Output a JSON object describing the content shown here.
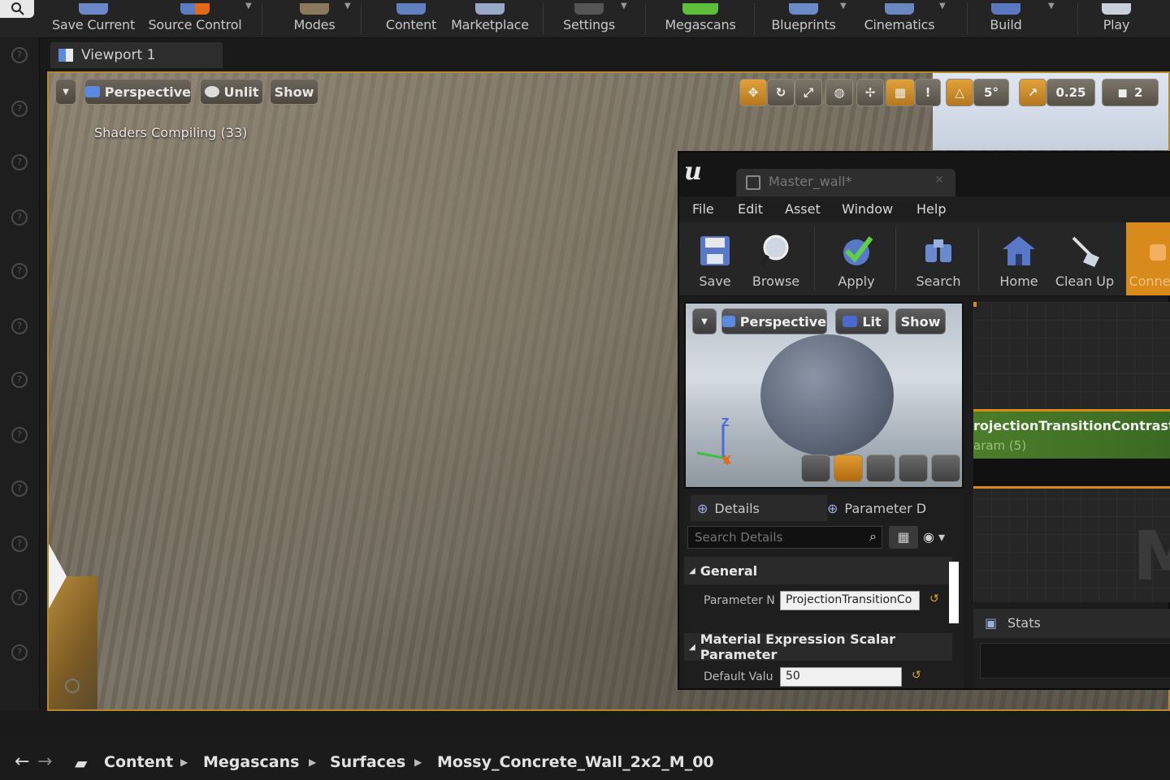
{
  "main_toolbar": {
    "buttons": [
      {
        "label": "Save Current",
        "icon": "save-icon"
      },
      {
        "label": "Source Control",
        "icon": "source-control-icon"
      },
      {
        "label": "Modes",
        "icon": "modes-icon"
      },
      {
        "label": "Content",
        "icon": "content-icon"
      },
      {
        "label": "Marketplace",
        "icon": "marketplace-icon"
      },
      {
        "label": "Settings",
        "icon": "settings-icon"
      },
      {
        "label": "Megascans",
        "icon": "megascans-icon"
      },
      {
        "label": "Blueprints",
        "icon": "blueprints-icon"
      },
      {
        "label": "Cinematics",
        "icon": "cinematics-icon"
      },
      {
        "label": "Build",
        "icon": "build-icon"
      },
      {
        "label": "Play",
        "icon": "play-icon"
      }
    ]
  },
  "viewport_tab": {
    "label": "Viewport 1"
  },
  "viewport": {
    "view_mode": "Perspective",
    "lighting_mode": "Unlit",
    "show_label": "Show",
    "status_message": "Shaders Compiling (33)",
    "snap_angle": "5°",
    "snap_scale": "0.25",
    "camera_speed": "2"
  },
  "material_editor": {
    "tab_title": "Master_wall*",
    "menu": [
      "File",
      "Edit",
      "Asset",
      "Window",
      "Help"
    ],
    "tools": [
      {
        "label": "Save",
        "icon": "save-icon"
      },
      {
        "label": "Browse",
        "icon": "browse-icon"
      },
      {
        "label": "Apply",
        "icon": "apply-icon"
      },
      {
        "label": "Search",
        "icon": "search-icon"
      },
      {
        "label": "Home",
        "icon": "home-icon"
      },
      {
        "label": "Clean Up",
        "icon": "clean-up-icon"
      },
      {
        "label": "Conne",
        "icon": "connectors-icon"
      }
    ],
    "preview": {
      "view_mode": "Perspective",
      "lighting_mode": "Lit",
      "show_label": "Show",
      "axis_z": "Z",
      "axis_x": "X"
    },
    "graph": {
      "node_title": "rojectionTransitionContrast (",
      "node_subtitle": "aram (5)",
      "watermark": "M"
    },
    "details": {
      "tab_label": "Details",
      "param_tab_label": "Parameter D",
      "search_placeholder": "Search Details",
      "general_section": "General",
      "param_name_label": "Parameter N",
      "param_name_value": "ProjectionTransitionCo",
      "expr_section": "Material Expression Scalar Parameter",
      "default_value_label": "Default Valu",
      "default_value": "50"
    },
    "stats_tab_label": "Stats"
  },
  "breadcrumb": [
    "Content",
    "Megascans",
    "Surfaces",
    "Mossy_Concrete_Wall_2x2_M_00"
  ],
  "colors": {
    "accent_orange": "#d88a1a",
    "node_green": "#4b7d2a",
    "viewport_border": "#b48a2a"
  }
}
